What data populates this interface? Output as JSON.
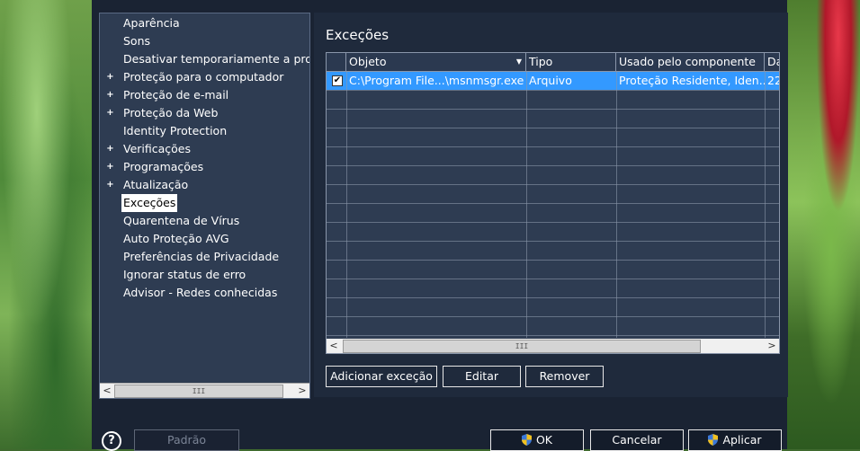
{
  "tree": {
    "items": [
      {
        "label": "Aparência",
        "expandable": false
      },
      {
        "label": "Sons",
        "expandable": false
      },
      {
        "label": "Desativar temporariamente a proteç",
        "expandable": false
      },
      {
        "label": "Proteção para o computador",
        "expandable": true
      },
      {
        "label": "Proteção de e-mail",
        "expandable": true
      },
      {
        "label": "Proteção da Web",
        "expandable": true
      },
      {
        "label": "Identity Protection",
        "expandable": false
      },
      {
        "label": "Verificações",
        "expandable": true
      },
      {
        "label": "Programações",
        "expandable": true
      },
      {
        "label": "Atualização",
        "expandable": true
      },
      {
        "label": "Exceções",
        "expandable": false,
        "selected": true
      },
      {
        "label": "Quarentena de Vírus",
        "expandable": false
      },
      {
        "label": "Auto Proteção AVG",
        "expandable": false
      },
      {
        "label": "Preferências de Privacidade",
        "expandable": false
      },
      {
        "label": "Ignorar status de erro",
        "expandable": false
      },
      {
        "label": "Advisor - Redes conhecidas",
        "expandable": false
      }
    ],
    "expand_symbol": "+",
    "scroll_left": "<",
    "scroll_right": ">",
    "scroll_grip": "III"
  },
  "content": {
    "title": "Exceções",
    "columns": [
      "Objeto",
      "Tipo",
      "Usado pelo componente",
      "Da"
    ],
    "sort_indicator": "▼",
    "rows": [
      {
        "checked": true,
        "check_symbol": "✔",
        "objeto": "C:\\Program File...\\msnmsgr.exe",
        "tipo": "Arquivo",
        "componente": "Proteção Residente, Iden...",
        "data": "22"
      }
    ],
    "buttons": {
      "add": "Adicionar exceção",
      "edit": "Editar",
      "remove": "Remover"
    }
  },
  "footer": {
    "help": "?",
    "default": "Padrão",
    "ok": "OK",
    "cancel": "Cancelar",
    "apply": "Aplicar"
  },
  "colors": {
    "selection": "#3399ff",
    "panel": "#2e3c52",
    "window": "#1a2333"
  }
}
